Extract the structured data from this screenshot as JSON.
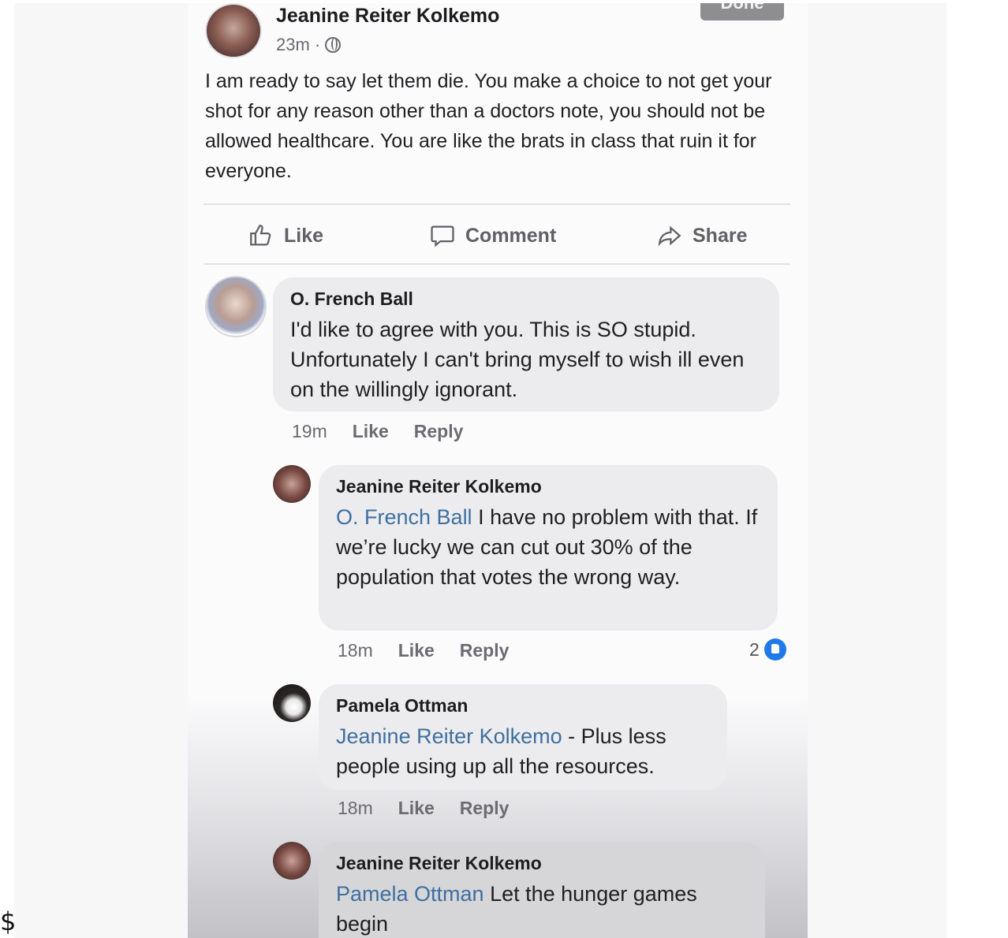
{
  "page": {
    "stray_char": "$"
  },
  "post": {
    "author": "Jeanine Reiter Kolkemo",
    "time": "23m ·",
    "text": "I am ready to say let them die.  You make a choice to not get your shot for any reason other than a doctors note, you should not be allowed healthcare. You are like the brats in class that ruin it for everyone.",
    "done_label": "Done"
  },
  "actions": {
    "like": "Like",
    "comment": "Comment",
    "share": "Share"
  },
  "comments": [
    {
      "name": "O. French Ball",
      "mention": "",
      "text": "I'd like to agree with you. This is SO stupid. Unfortunately I can't bring myself to wish ill even on the willingly ignorant.",
      "time": "19m",
      "like": "Like",
      "reply": "Reply"
    },
    {
      "name": "Jeanine Reiter Kolkemo",
      "mention": "O. French Ball",
      "text": " I have no problem with that. If we’re lucky we can cut out 30% of the population that votes the wrong way.",
      "time": "18m",
      "like": "Like",
      "reply": "Reply",
      "reactions": "2"
    },
    {
      "name": "Pamela Ottman",
      "mention": "Jeanine Reiter Kolkemo",
      "text": " - Plus less people using up all the resources.",
      "time": "18m",
      "like": "Like",
      "reply": "Reply"
    },
    {
      "name": "Jeanine Reiter Kolkemo",
      "mention": "Pamela Ottman",
      "text": " Let the hunger games begin",
      "time": "",
      "like": "",
      "reply": ""
    }
  ],
  "icons": {
    "like": "thumbs-up-icon",
    "comment": "speech-bubble-icon",
    "share": "share-arrow-icon",
    "privacy": "globe-icon",
    "reaction": "like-reaction-icon"
  }
}
